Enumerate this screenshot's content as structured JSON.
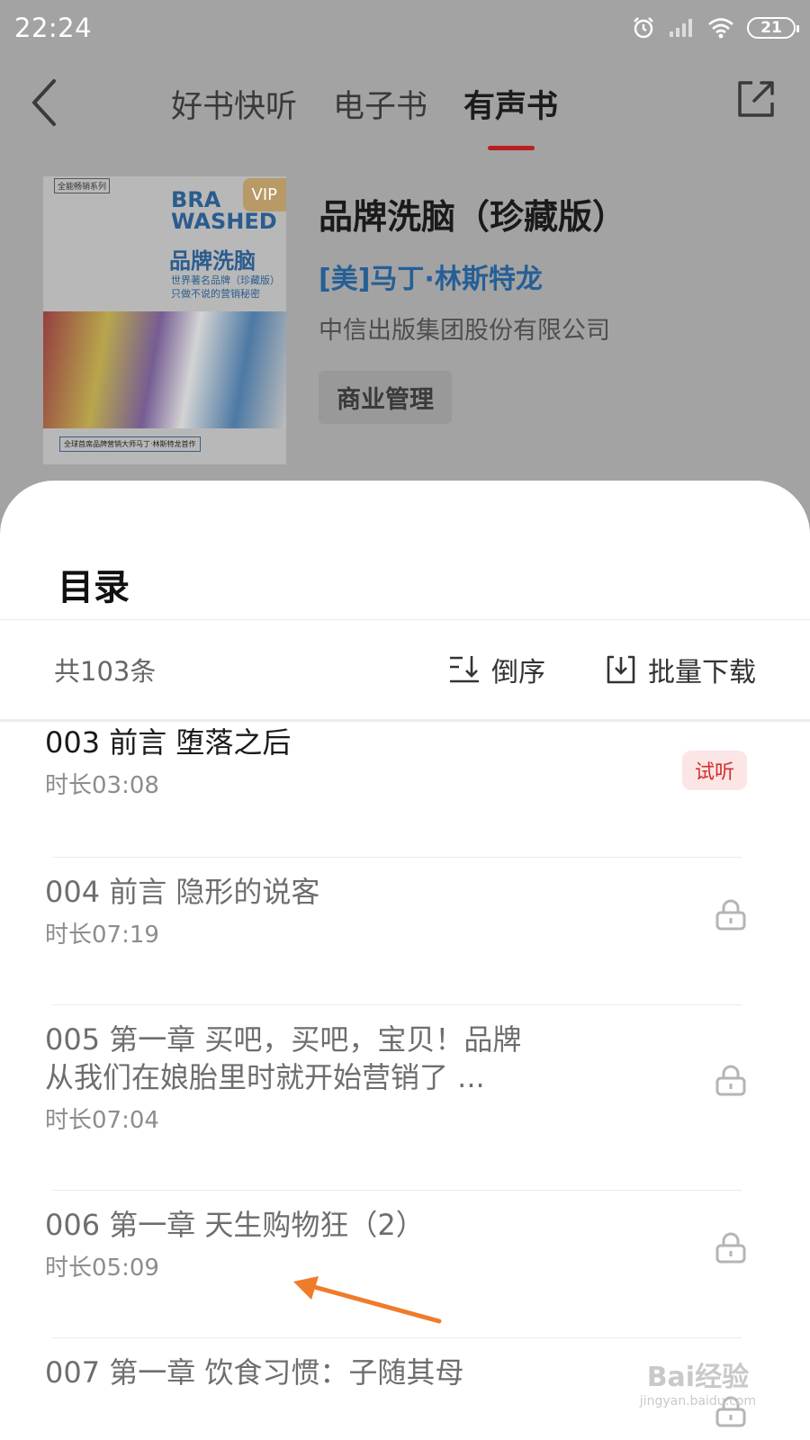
{
  "status_bar": {
    "time": "22:24",
    "battery": "21"
  },
  "nav": {
    "tabs": [
      {
        "label": "好书快听"
      },
      {
        "label": "电子书"
      },
      {
        "label": "有声书"
      }
    ]
  },
  "book": {
    "cover": {
      "series": "全能畅销系列",
      "title_en": "BRA WASHED",
      "title_cn": "品牌洗脑",
      "subtitle_1": "世界著名品牌（珍藏版）",
      "subtitle_2": "只做不说的营销秘密",
      "vip": "VIP",
      "blurb": "全球首席品牌营销大师马丁·林斯特龙首作"
    },
    "title": "品牌洗脑（珍藏版）",
    "author": "[美]马丁·林斯特龙",
    "publisher": "中信出版集团股份有限公司",
    "tag": "商业管理"
  },
  "catalog": {
    "heading": "目录",
    "count": "共103条",
    "sort_label": "倒序",
    "download_label": "批量下载",
    "items": [
      {
        "title": "003 前言 堕落之后",
        "duration": "时长03:08",
        "badge": "试听"
      },
      {
        "title": "004 前言 隐形的说客",
        "duration": "时长07:19"
      },
      {
        "title_line1": "005 第一章 买吧，买吧，宝贝！品牌",
        "title_line2": "从我们在娘胎里时就开始营销了 ...",
        "duration": "时长07:04"
      },
      {
        "title": "006 第一章 天生购物狂（2）",
        "duration": "时长05:09"
      },
      {
        "title": "007 第一章 饮食习惯：子随其母"
      }
    ]
  },
  "watermark": {
    "main": "Bai经验",
    "sub": "jingyan.baidu.com"
  },
  "colors": {
    "accent": "#b81f1f",
    "author": "#255f96",
    "trial_bg": "#fbe5e5",
    "trial_text": "#d03030"
  }
}
